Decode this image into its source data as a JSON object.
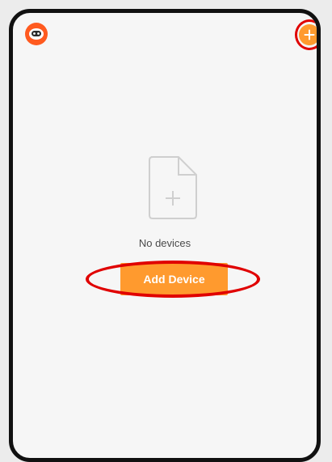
{
  "header": {
    "avatar_icon": "robot-avatar-icon",
    "add_icon": "plus-circle-icon"
  },
  "empty_state": {
    "icon": "new-file-icon",
    "message": "No devices",
    "button_label": "Add Device"
  },
  "colors": {
    "accent": "#ff9a2e",
    "avatar": "#ff5a1f",
    "highlight_ring": "#e00000",
    "background": "#f6f6f6",
    "frame": "#111111"
  }
}
